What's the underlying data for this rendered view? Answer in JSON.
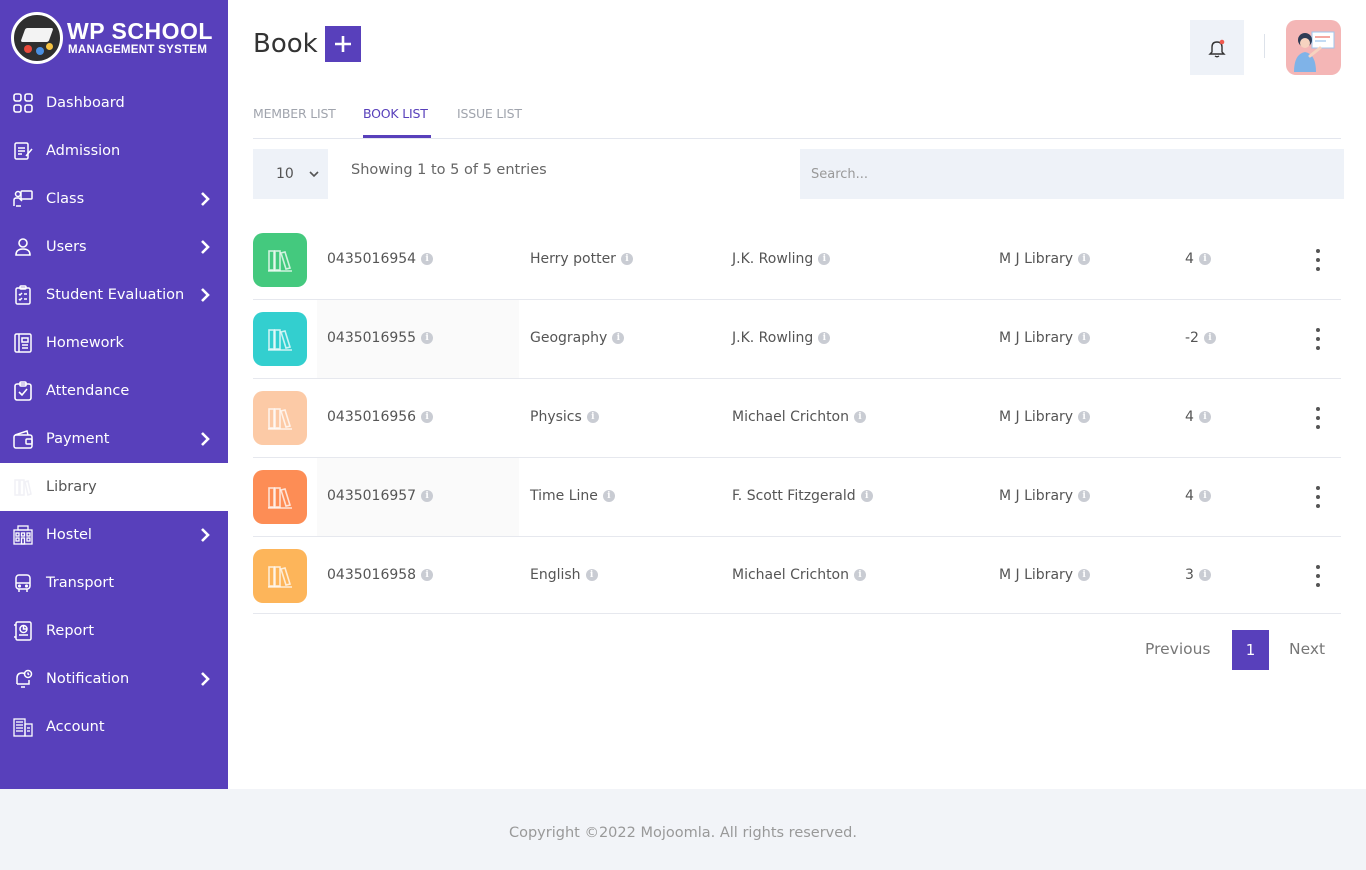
{
  "app": {
    "logo_title": "WP SCHOOL",
    "logo_subtitle": "MANAGEMENT SYSTEM"
  },
  "sidebar": {
    "items": [
      {
        "label": "Dashboard",
        "icon": "dashboard-icon",
        "has_submenu": false
      },
      {
        "label": "Admission",
        "icon": "admission-icon",
        "has_submenu": false
      },
      {
        "label": "Class",
        "icon": "class-icon",
        "has_submenu": true
      },
      {
        "label": "Users",
        "icon": "user-icon",
        "has_submenu": true
      },
      {
        "label": "Student Evaluation",
        "icon": "evaluation-icon",
        "has_submenu": true
      },
      {
        "label": "Homework",
        "icon": "homework-icon",
        "has_submenu": false
      },
      {
        "label": "Attendance",
        "icon": "attendance-icon",
        "has_submenu": false
      },
      {
        "label": "Payment",
        "icon": "wallet-icon",
        "has_submenu": true
      },
      {
        "label": "Library",
        "icon": "library-icon",
        "has_submenu": false,
        "active": true
      },
      {
        "label": "Hostel",
        "icon": "hostel-icon",
        "has_submenu": true
      },
      {
        "label": "Transport",
        "icon": "bus-icon",
        "has_submenu": false
      },
      {
        "label": "Report",
        "icon": "report-icon",
        "has_submenu": false
      },
      {
        "label": "Notification",
        "icon": "notification-icon",
        "has_submenu": true
      },
      {
        "label": "Account",
        "icon": "account-icon",
        "has_submenu": false
      }
    ]
  },
  "header": {
    "title": "Book",
    "add_label": "+"
  },
  "tabs": [
    {
      "label": "MEMBER LIST",
      "active": false
    },
    {
      "label": "BOOK LIST",
      "active": true
    },
    {
      "label": "ISSUE LIST",
      "active": false
    }
  ],
  "controls": {
    "page_size": "10",
    "entries_info": "Showing 1 to 5 of 5 entries",
    "search_placeholder": "Search..."
  },
  "books": [
    {
      "isbn": "0435016954",
      "title": "Herry potter",
      "author": "J.K. Rowling",
      "library": "M J Library",
      "quantity": "4",
      "icon_color": "#44c97e"
    },
    {
      "isbn": "0435016955",
      "title": "Geography",
      "author": "J.K. Rowling",
      "library": "M J Library",
      "quantity": "-2",
      "icon_color": "#33cfcf"
    },
    {
      "isbn": "0435016956",
      "title": "Physics",
      "author": "Michael Crichton",
      "library": "M J Library",
      "quantity": "4",
      "icon_color": "#fccaa6"
    },
    {
      "isbn": "0435016957",
      "title": "Time Line",
      "author": "F. Scott Fitzgerald",
      "library": "M J Library",
      "quantity": "4",
      "icon_color": "#fd8d55"
    },
    {
      "isbn": "0435016958",
      "title": "English",
      "author": "Michael Crichton",
      "library": "M J Library",
      "quantity": "3",
      "icon_color": "#fdb55a"
    }
  ],
  "pagination": {
    "previous": "Previous",
    "current": "1",
    "next": "Next"
  },
  "footer": {
    "copyright": "Copyright ©2022 Mojoomla. All rights reserved."
  },
  "colors": {
    "accent": "#5840bb",
    "panel": "#eef2f8"
  }
}
